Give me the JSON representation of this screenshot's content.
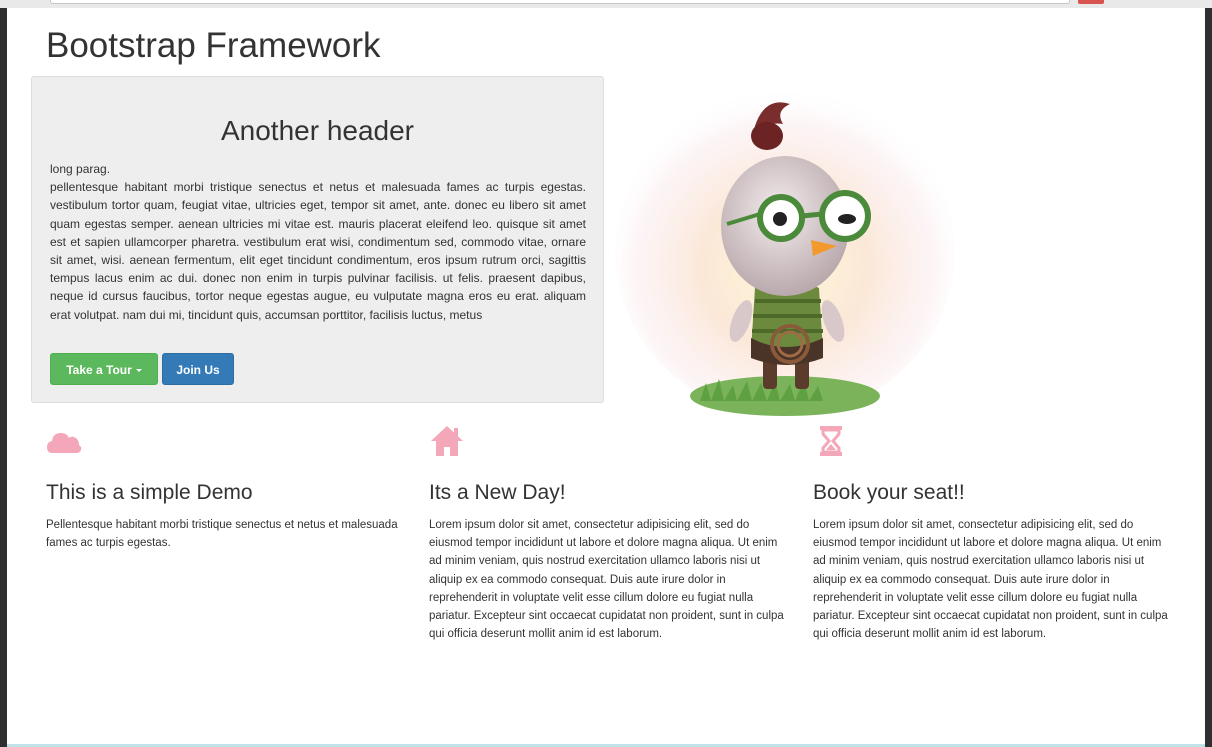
{
  "colors": {
    "success": "#5cb85c",
    "primary": "#337ab7",
    "icon_pink": "#f4a7b9",
    "jumbotron_bg": "#eeeeee"
  },
  "page": {
    "title": "Bootstrap Framework"
  },
  "jumbotron": {
    "heading": "Another header",
    "intro": "long parag.",
    "body": "pellentesque habitant morbi tristique senectus et netus et malesuada fames ac turpis egestas. vestibulum tortor quam, feugiat vitae, ultricies eget, tempor sit amet, ante. donec eu libero sit amet quam egestas semper. aenean ultricies mi vitae est. mauris placerat eleifend leo. quisque sit amet est et sapien ullamcorper pharetra. vestibulum erat wisi, condimentum sed, commodo vitae, ornare sit amet, wisi. aenean fermentum, elit eget tincidunt condimentum, eros ipsum rutrum orci, sagittis tempus lacus enim ac dui. donec non enim in turpis pulvinar facilisis. ut felis. praesent dapibus, neque id cursus faucibus, tortor neque egestas augue, eu vulputate magna eros eu erat. aliquam erat volutpat. nam dui mi, tincidunt quis, accumsan porttitor, facilisis luctus, metus",
    "buttons": {
      "tour_label": "Take a Tour",
      "join_label": "Join Us"
    }
  },
  "features": [
    {
      "icon": "cloud-icon",
      "title": "This is a simple Demo",
      "text": "Pellentesque habitant morbi tristique senectus et netus et malesuada fames ac turpis egestas."
    },
    {
      "icon": "home-icon",
      "title": "Its a New Day!",
      "text": "Lorem ipsum dolor sit amet, consectetur adipisicing elit, sed do eiusmod tempor incididunt ut labore et dolore magna aliqua. Ut enim ad minim veniam, quis nostrud exercitation ullamco laboris nisi ut aliquip ex ea commodo consequat. Duis aute irure dolor in reprehenderit in voluptate velit esse cillum dolore eu fugiat nulla pariatur. Excepteur sint occaecat cupidatat non proident, sunt in culpa qui officia deserunt mollit anim id est laborum."
    },
    {
      "icon": "hourglass-icon",
      "title": "Book your seat!!",
      "text": "Lorem ipsum dolor sit amet, consectetur adipisicing elit, sed do eiusmod tempor incididunt ut labore et dolore magna aliqua. Ut enim ad minim veniam, quis nostrud exercitation ullamco laboris nisi ut aliquip ex ea commodo consequat. Duis aute irure dolor in reprehenderit in voluptate velit esse cillum dolore eu fugiat nulla pariatur. Excepteur sint occaecat cupidatat non proident, sunt in culpa qui officia deserunt mollit anim id est laborum."
    }
  ]
}
